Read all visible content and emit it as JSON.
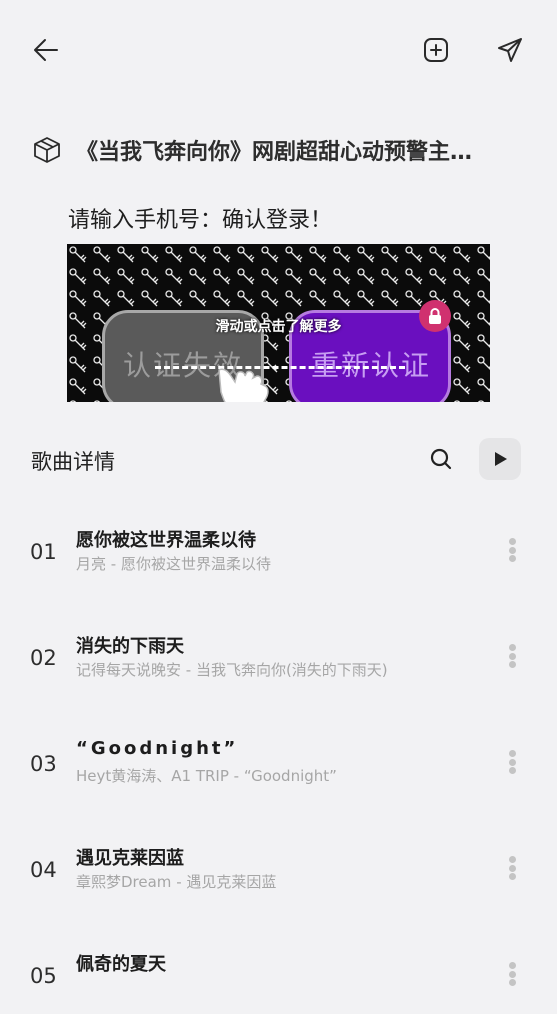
{
  "header": {
    "back_icon": "arrow-left-icon",
    "add_icon": "plus-square-icon",
    "share_icon": "paper-plane-icon"
  },
  "title": {
    "icon": "box-icon",
    "text": "《当我飞奔向你》网剧超甜心动预警主…"
  },
  "login_prompt": "请输入手机号：确认登录！",
  "banner": {
    "overlay_text": "滑动或点击了解更多",
    "left_button": "认证失效",
    "right_button": "重新认证",
    "lock_icon": "lock-icon",
    "hand_icon": "hand-pointer-icon",
    "colors": {
      "left": "#5a5a5a",
      "right": "#6a0fbf",
      "lock": "#d0316f"
    }
  },
  "section": {
    "title": "歌曲详情",
    "search_icon": "search-icon",
    "play_icon": "play-icon"
  },
  "songs": [
    {
      "num": "01",
      "name": "愿你被这世界温柔以待",
      "sub": "月亮 - 愿你被这世界温柔以待"
    },
    {
      "num": "02",
      "name": "消失的下雨天",
      "sub": "记得每天说晚安 - 当我飞奔向你(消失的下雨天)"
    },
    {
      "num": "03",
      "name": "“Goodnight”",
      "sub": "Heyt黄海涛、A1 TRIP - “Goodnight”"
    },
    {
      "num": "04",
      "name": "遇见克莱因蓝",
      "sub": "章熙梦Dream - 遇见克莱因蓝"
    },
    {
      "num": "05",
      "name": "佩奇的夏天",
      "sub": ""
    }
  ]
}
